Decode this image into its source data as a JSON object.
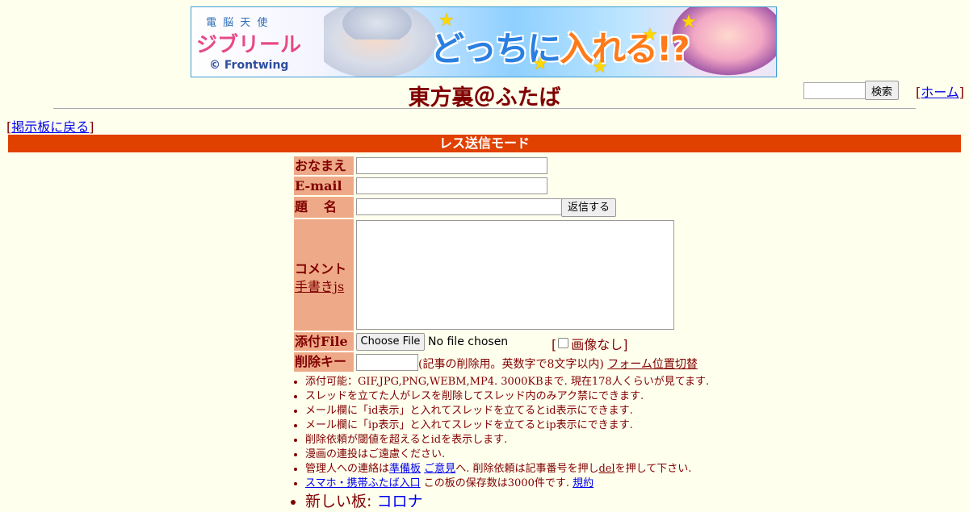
{
  "banner": {
    "logo_top": "電 脳 天 使",
    "logo_main": "ジブリール",
    "copyright": "© Frontwing",
    "catch_1": "どっちに",
    "catch_2": "入れる!?"
  },
  "header": {
    "title": "東方裏＠ふたば",
    "search_button": "検索",
    "home_link": "ホーム",
    "back_link": "掲示板に戻る"
  },
  "mode_bar": "レス送信モード",
  "form": {
    "name_label": "おなまえ",
    "email_label": "E-mail",
    "subject_label": "題　名",
    "submit_button": "返信する",
    "comment_label": "コメント",
    "handwriting_link": "手書きjs",
    "file_label": "添付File",
    "choose_file_button": "Choose File",
    "no_file_text": "No file chosen",
    "no_image_label": "画像なし",
    "delete_key_label": "削除キー",
    "delete_key_note": "(記事の削除用。英数字で8文字以内)",
    "form_position_link": "フォーム位置切替"
  },
  "notes": {
    "items": [
      "添付可能：GIF,JPG,PNG,WEBM,MP4. 3000KBまで. 現在178人くらいが見てます.",
      "スレッドを立てた人がレスを削除してスレッド内のみアク禁にできます.",
      "メール欄に「id表示」と入れてスレッドを立てるとid表示にできます.",
      "メール欄に「ip表示」と入れてスレッドを立てるとip表示にできます.",
      "削除依頼が閾値を超えるとidを表示します.",
      "漫画の連投はご遠慮ください."
    ],
    "contact_prefix": "管理人への連絡は",
    "contact_link1": "準備板",
    "contact_link2": "ご意見",
    "contact_mid": "へ. 削除依頼は記事番号を押し",
    "contact_del": "del",
    "contact_suffix": "を押して下さい.",
    "mobile_link": "スマホ・携帯ふたば入口",
    "storage_text": " この板の保存数は3000件です. ",
    "rules_link": "規約",
    "new_board_prefix": "新しい板: ",
    "new_board_link": "コロナ"
  }
}
